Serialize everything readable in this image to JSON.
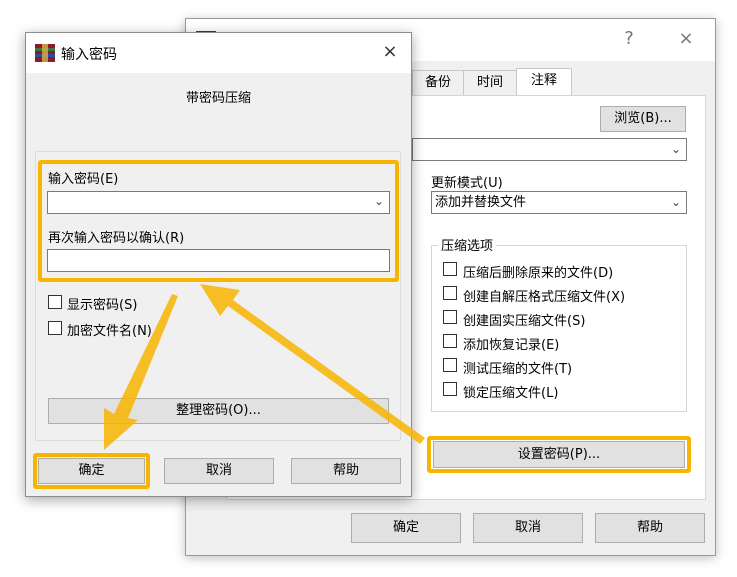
{
  "back_dialog": {
    "tabs": [
      "备份",
      "时间",
      "注释"
    ],
    "active_tab": "注释",
    "browse_button": "浏览(B)...",
    "update_mode_label": "更新模式(U)",
    "update_mode_value": "添加并替换文件",
    "compress_options_title": "压缩选项",
    "options": [
      "压缩后删除原来的文件(D)",
      "创建自解压格式压缩文件(X)",
      "创建固实压缩文件(S)",
      "添加恢复记录(E)",
      "测试压缩的文件(T)",
      "锁定压缩文件(L)"
    ],
    "set_password_button": "设置密码(P)...",
    "ok_button": "确定",
    "cancel_button": "取消",
    "help_button": "帮助",
    "title_help": "?",
    "title_close": "×"
  },
  "front_dialog": {
    "title": "输入密码",
    "close_glyph": "×",
    "heading": "带密码压缩",
    "password_label": "输入密码(E)",
    "password_value": "",
    "confirm_label": "再次输入密码以确认(R)",
    "confirm_value": "",
    "show_password": "显示密码(S)",
    "encrypt_filenames": "加密文件名(N)",
    "organize_button": "整理密码(O)...",
    "ok_button": "确定",
    "cancel_button": "取消",
    "help_button": "帮助"
  },
  "colors": {
    "highlight": "#f7b500",
    "dialog_bg": "#f0f0f0",
    "button_bg": "#e1e1e1"
  }
}
